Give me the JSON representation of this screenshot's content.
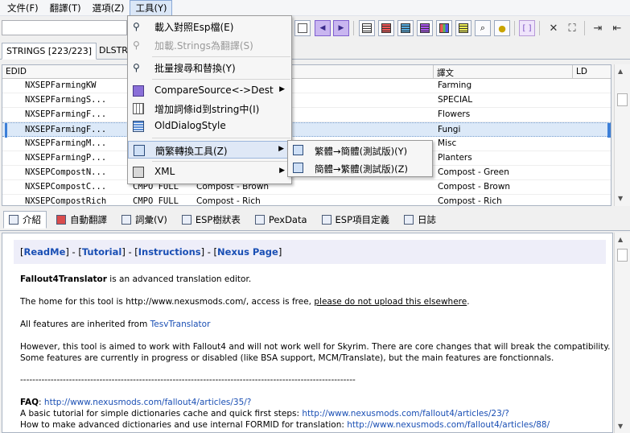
{
  "menubar": [
    "文件(F)",
    "翻譯(T)",
    "選項(Z)",
    "工具(Y)"
  ],
  "search": {
    "value": ""
  },
  "grid_tabs": [
    "STRINGS [223/223]",
    "DLSTRI"
  ],
  "grid": {
    "headers": [
      "EDID",
      "譯文",
      "LD"
    ],
    "rows": [
      {
        "edid": "NXSEPFarmingKW",
        "c1": "",
        "c2": "",
        "trans": "Farming",
        "selected": false
      },
      {
        "edid": "NXSEPFarmingS...",
        "c1": "",
        "c2": "",
        "trans": "SPECIAL",
        "selected": false
      },
      {
        "edid": "NXSEPFarmingF...",
        "c1": "",
        "c2": "",
        "trans": "Flowers",
        "selected": false
      },
      {
        "edid": "NXSEPFarmingF...",
        "c1": "",
        "c2": "",
        "trans": "Fungi",
        "selected": true
      },
      {
        "edid": "NXSEPFarmingM...",
        "c1": "",
        "c2": "",
        "trans": "Misc",
        "selected": false
      },
      {
        "edid": "NXSEPFarmingP...",
        "c1": "",
        "c2": "",
        "trans": "Planters",
        "selected": false
      },
      {
        "edid": "NXSEPCompostN...",
        "c1": "CMPO FULL",
        "c2": "Compost - Brown",
        "trans": "Compost - Green",
        "selected": false
      },
      {
        "edid": "NXSEPCompostC...",
        "c1": "CMPO FULL",
        "c2": "Compost - Brown",
        "trans": "Compost - Brown",
        "selected": false
      },
      {
        "edid": "NXSEPCompostRich",
        "c1": "CMPO FULL",
        "c2": "Compost - Rich",
        "trans": "Compost - Rich",
        "selected": false
      }
    ]
  },
  "bottom_tabs": [
    "介紹",
    "自動翻譯",
    "詞彙(V)",
    "ESP樹狀表",
    "PexData",
    "ESP項目定義",
    "日誌"
  ],
  "content": {
    "banner": {
      "links": [
        "ReadMe",
        "Tutorial",
        "Instructions",
        "Nexus Page"
      ]
    },
    "title_bold": "Fallout4Translator",
    "title_rest": " is an advanced translation editor.",
    "home_text": "The home for this tool is http://www.nexusmods.com/, access is free, ",
    "home_underline": "please do not upload this elsewhere",
    "home_end": ".",
    "inherit_text": "All features are inherited from ",
    "inherit_link": "TesvTranslator",
    "however_1": "However, this tool is aimed to work with Fallout4 and will not work well for Skyrim. There are core changes that will break the compatibility.",
    "however_2": "Some features are currently in progress or disabled (like BSA support, MCM/Translate), but the main features are fonctionnals.",
    "divider": "--------------------------------------------------------------------------------------------------------------",
    "faq_label": "FAQ",
    "faq_colon": ": ",
    "faq_link": "http://www.nexusmods.com/fallout4/articles/35/?",
    "tut_text": "A basic tutorial for simple dictionaries cache and quick first steps: ",
    "tut_link": "http://www.nexusmods.com/fallout4/articles/23/?",
    "adv_text": "How to make advanced dictionaries and use internal FORMID for translation: ",
    "adv_link": "http://www.nexusmods.com/fallout4/articles/88/"
  },
  "tools_menu": {
    "items": [
      {
        "label": "載入對照Esp檔(E)",
        "icon": "magnifier-icon",
        "disabled": false,
        "arrow": false
      },
      {
        "label": "加載.Strings為翻譯(S)",
        "icon": "magnifier-icon",
        "disabled": true,
        "arrow": false
      },
      {
        "label": "批量搜尋和替換(Y)",
        "icon": "magnifier-replace-icon",
        "disabled": false,
        "arrow": false
      },
      {
        "label": "CompareSource<->Dest",
        "icon": "compare-icon",
        "disabled": false,
        "arrow": true
      },
      {
        "label": "增加詞條id到string中(I)",
        "icon": "table-icon",
        "disabled": false,
        "arrow": false
      },
      {
        "label": "OldDialogStyle",
        "icon": "dialog-icon",
        "disabled": false,
        "arrow": false
      },
      {
        "label": "簡繁轉換工具(Z)",
        "icon": "convert-icon",
        "disabled": false,
        "arrow": true
      },
      {
        "label": "XML",
        "icon": "xml-icon",
        "disabled": false,
        "arrow": true
      }
    ]
  },
  "convert_submenu": [
    "繁體→簡體(測試版)(Y)",
    "簡體→繁體(測試版)(Z)"
  ],
  "colors": {
    "accent": "#3c7fd8",
    "link": "#1a4fb4",
    "purple": "#c9b6f0"
  }
}
